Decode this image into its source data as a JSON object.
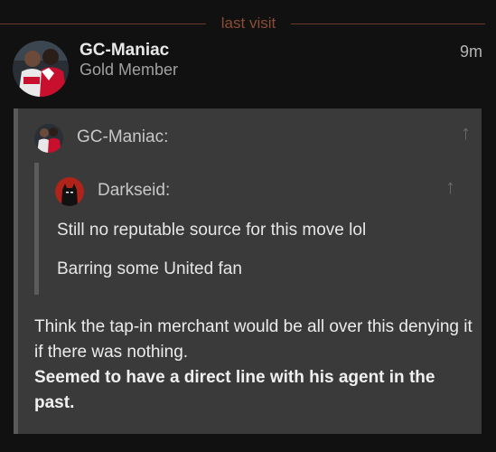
{
  "separator": {
    "label": "last visit"
  },
  "post": {
    "author": "GC-Maniac",
    "author_title": "Gold Member",
    "time": "9m"
  },
  "quote": {
    "username": "GC-Maniac:",
    "nested_quote": {
      "username": "Darkseid:",
      "lines": [
        "Still no reputable source for this move lol",
        "Barring some United fan"
      ]
    }
  },
  "body": {
    "text": "Think the tap-in merchant would be all over this denying it if there was nothing.",
    "bold_text": "Seemed to have a direct line with his agent in the past."
  },
  "icons": {
    "jump_to_post": "arrow-up-icon"
  },
  "colors": {
    "background": "#111111",
    "quote_background": "#3a3a3a",
    "separator_accent": "#8a4d36"
  }
}
